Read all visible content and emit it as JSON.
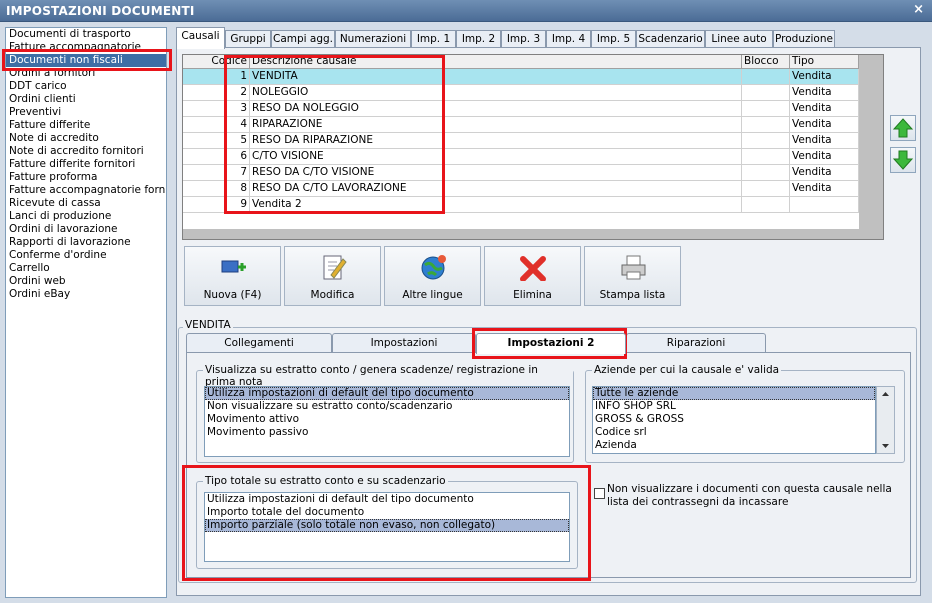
{
  "window": {
    "title": "IMPOSTAZIONI DOCUMENTI",
    "close": "×"
  },
  "doc_types": [
    "Documenti di trasporto",
    "Fatture accompagnatorie",
    "Documenti non fiscali",
    "Ordini a fornitori",
    "DDT carico",
    "Ordini clienti",
    "Preventivi",
    "Fatture differite",
    "Note di accredito",
    "Note di accredito fornitori",
    "Fatture differite fornitori",
    "Fatture proforma",
    "Fatture accompagnatorie fornito",
    "Ricevute di cassa",
    "Lanci di produzione",
    "Ordini di lavorazione",
    "Rapporti di lavorazione",
    "Conferme d'ordine",
    "Carrello",
    "Ordini web",
    "Ordini eBay"
  ],
  "doc_types_selected": 2,
  "tabs": [
    "Causali",
    "Gruppi",
    "Campi agg.",
    "Numerazioni",
    "Imp. 1",
    "Imp. 2",
    "Imp. 3",
    "Imp. 4",
    "Imp. 5",
    "Scadenzario",
    "Linee auto",
    "Produzione"
  ],
  "grid": {
    "headers": {
      "codice": "Codice",
      "descrizione": "Descrizione causale",
      "blocco": "Blocco",
      "tipo": "Tipo"
    },
    "rows": [
      {
        "codice": "1",
        "descrizione": "VENDITA",
        "blocco": "",
        "tipo": "Vendita"
      },
      {
        "codice": "2",
        "descrizione": "NOLEGGIO",
        "blocco": "",
        "tipo": "Vendita"
      },
      {
        "codice": "3",
        "descrizione": "RESO DA NOLEGGIO",
        "blocco": "",
        "tipo": "Vendita"
      },
      {
        "codice": "4",
        "descrizione": "RIPARAZIONE",
        "blocco": "",
        "tipo": "Vendita"
      },
      {
        "codice": "5",
        "descrizione": "RESO DA RIPARAZIONE",
        "blocco": "",
        "tipo": "Vendita"
      },
      {
        "codice": "6",
        "descrizione": "C/TO VISIONE",
        "blocco": "",
        "tipo": "Vendita"
      },
      {
        "codice": "7",
        "descrizione": "RESO DA C/TO VISIONE",
        "blocco": "",
        "tipo": "Vendita"
      },
      {
        "codice": "8",
        "descrizione": "RESO DA C/TO LAVORAZIONE",
        "blocco": "",
        "tipo": "Vendita"
      },
      {
        "codice": "9",
        "descrizione": "Vendita 2",
        "blocco": "",
        "tipo": ""
      }
    ]
  },
  "toolbar": {
    "nuova": "Nuova (F4)",
    "modifica": "Modifica",
    "altre_lingue": "Altre lingue",
    "elimina": "Elimina",
    "stampa": "Stampa lista"
  },
  "detail": {
    "group_title": "VENDITA",
    "subtabs": [
      "Collegamenti",
      "Impostazioni",
      "Impostazioni 2",
      "Riparazioni"
    ],
    "visualizza": {
      "title": "Visualizza su estratto conto / genera scadenze/ registrazione  in prima nota",
      "items": [
        "Utilizza impostazioni di default del tipo documento",
        "Non visualizzare su estratto conto/scadenzario",
        "Movimento attivo",
        "Movimento passivo"
      ]
    },
    "aziende": {
      "title": "Aziende per cui la causale e' valida",
      "items": [
        "Tutte le aziende",
        "INFO SHOP SRL",
        "GROSS & GROSS",
        "Codice srl",
        "Azienda"
      ]
    },
    "tipo_totale": {
      "title": "Tipo totale su estratto conto e su scadenzario",
      "items": [
        "Utilizza impostazioni di default del tipo documento",
        "Importo totale del documento",
        "Importo parziale (solo totale non evaso, non collegato)"
      ]
    },
    "checkbox_label": "Non visualizzare i documenti con questa causale nella lista dei contrassegni da incassare"
  },
  "colors": {
    "accent_red": "#e8141a",
    "row_highlight": "#a8e4ef",
    "selection": "#3d6ea5"
  }
}
